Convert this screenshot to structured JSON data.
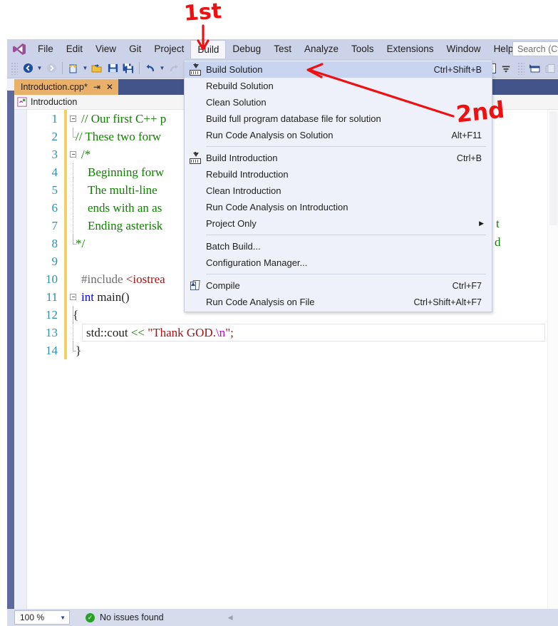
{
  "menubar": {
    "logo_icon": "visual-studio-logo",
    "items": [
      {
        "label": "File"
      },
      {
        "label": "Edit"
      },
      {
        "label": "View"
      },
      {
        "label": "Git"
      },
      {
        "label": "Project"
      },
      {
        "label": "Build",
        "open": true
      },
      {
        "label": "Debug"
      },
      {
        "label": "Test"
      },
      {
        "label": "Analyze"
      },
      {
        "label": "Tools"
      },
      {
        "label": "Extensions"
      },
      {
        "label": "Window"
      },
      {
        "label": "Help"
      }
    ],
    "search_placeholder": "Search (Ctrl"
  },
  "toolbar": {
    "icons": [
      "navigate-back-icon",
      "dropdown-caret-icon",
      "navigate-forward-icon",
      "new-project-icon",
      "dropdown-caret-icon",
      "open-file-icon",
      "save-icon",
      "save-all-icon",
      "undo-icon",
      "dropdown-caret-icon",
      "redo-icon"
    ],
    "right_icons": [
      "solution-explorer-icon",
      "filter-icon",
      "properties-window-icon",
      "toolbox-icon"
    ]
  },
  "tab": {
    "label": "Introduction.cpp*",
    "pin_icon": "pin-icon",
    "close_icon": "close-icon"
  },
  "navbar": {
    "project_icon": "cpp-project-icon",
    "label": "Introduction"
  },
  "build_menu": {
    "rows": [
      {
        "label": "Build Solution",
        "shortcut": "Ctrl+Shift+B",
        "icon": "build-solution-icon",
        "selected": true
      },
      {
        "label": "Rebuild Solution",
        "shortcut": "",
        "icon": ""
      },
      {
        "label": "Clean Solution",
        "shortcut": "",
        "icon": ""
      },
      {
        "label": "Build full program database file for solution",
        "shortcut": "",
        "icon": ""
      },
      {
        "label": "Run Code Analysis on Solution",
        "shortcut": "Alt+F11",
        "icon": ""
      },
      {
        "separator": true
      },
      {
        "label": "Build Introduction",
        "shortcut": "Ctrl+B",
        "icon": "build-project-icon"
      },
      {
        "label": "Rebuild Introduction",
        "shortcut": "",
        "icon": ""
      },
      {
        "label": "Clean Introduction",
        "shortcut": "",
        "icon": ""
      },
      {
        "label": "Run Code Analysis on Introduction",
        "shortcut": "",
        "icon": ""
      },
      {
        "label": "Project Only",
        "shortcut": "",
        "icon": "",
        "submenu": true
      },
      {
        "separator": true
      },
      {
        "label": "Batch Build...",
        "shortcut": "",
        "icon": ""
      },
      {
        "label": "Configuration Manager...",
        "shortcut": "",
        "icon": ""
      },
      {
        "separator": true
      },
      {
        "label": "Compile",
        "shortcut": "Ctrl+F7",
        "icon": "compile-icon"
      },
      {
        "label": "Run Code Analysis on File",
        "shortcut": "Ctrl+Shift+Alt+F7",
        "icon": ""
      }
    ]
  },
  "editor": {
    "lines": [
      {
        "num": "1",
        "text": "// Our first C++ p"
      },
      {
        "num": "2",
        "text": "// These two forw"
      },
      {
        "num": "3",
        "text": "/*"
      },
      {
        "num": "4",
        "text": "Beginning forw"
      },
      {
        "num": "5",
        "text": "The multi-line "
      },
      {
        "num": "6",
        "text": "ends with an as"
      },
      {
        "num": "7",
        "text": "Ending asterisk"
      },
      {
        "num": "8",
        "text": "*/"
      },
      {
        "num": "9",
        "text": ""
      },
      {
        "num": "10",
        "text": "#include <iostrea"
      },
      {
        "num": "11",
        "text": "int main()"
      },
      {
        "num": "12",
        "text": "{"
      },
      {
        "num": "13",
        "text": "std::cout << \"Thank GOD.\\n\";"
      },
      {
        "num": "14",
        "text": "}"
      }
    ],
    "line1_comment": "// Our first C++ p",
    "line2_comment": "// These two forw",
    "line3_comment": "/*",
    "line4_comment": "Beginning forw",
    "line5_comment": "The multi-line ",
    "line6_comment": "ends with an as",
    "line7_comment": "Ending asterisk",
    "line8_comment": "*/",
    "line10_pre": "#include ",
    "line10_incl": "<iostrea",
    "line11_kw": "int",
    "line11_rest": " main()",
    "line12": "{",
    "line13_a": "std::cout ",
    "line13_op": "<<",
    "line13_str": " \"Thank GOD.",
    "line13_esc": "\\n",
    "line13_str2": "\";",
    "line14": "}",
    "edge_frag_top": "t",
    "edge_frag_bottom": "d"
  },
  "statusbar": {
    "zoom": "100 %",
    "zoom_caret_icon": "dropdown-caret-icon",
    "status_icon": "check-circle-icon",
    "status_text": "No issues found",
    "prev_issue_icon": "prev-arrow-icon"
  },
  "annotations": {
    "first": "1st",
    "second": "2nd",
    "arrow_color": "#ee1111"
  }
}
